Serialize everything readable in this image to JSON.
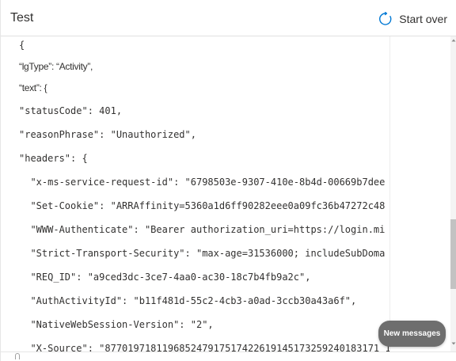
{
  "header": {
    "title": "Test",
    "start_over_label": "Start over",
    "start_over_icon": "restart-icon"
  },
  "transcript": {
    "lines": [
      "{",
      "“lgType”: “Activity”,",
      "“text”: {",
      "\"statusCode\": 401,",
      "\"reasonPhrase\": \"Unauthorized\",",
      "\"headers\": {",
      "  \"x-ms-service-request-id\": \"6798503e-9307-410e-8b4d-00669b7dee",
      "  \"Set-Cookie\": \"ARRAffinity=5360a1d6ff90282eee0a09fc36b47272c48",
      "  \"WWW-Authenticate\": \"Bearer authorization_uri=https://login.mi",
      "  \"Strict-Transport-Security\": \"max-age=31536000; includeSubDoma",
      "  \"REQ_ID\": \"a9ced3dc-3ce7-4aa0-ac30-18c7b4fb9a2c\",",
      "  \"AuthActivityId\": \"b11f481d-55c2-4cb3-a0ad-3ccb30a43a6f\",",
      "  \"NativeWebSession-Version\": \"2\",",
      "  \"X-Source\": \"877019718119685247917517422619145173259240183171 1"
    ]
  },
  "new_messages_label": "New messages",
  "colors": {
    "text": "#323130",
    "accent": "#0078d4",
    "pill": "#6e6e6e",
    "scroll_thumb": "#c2c2c2"
  }
}
